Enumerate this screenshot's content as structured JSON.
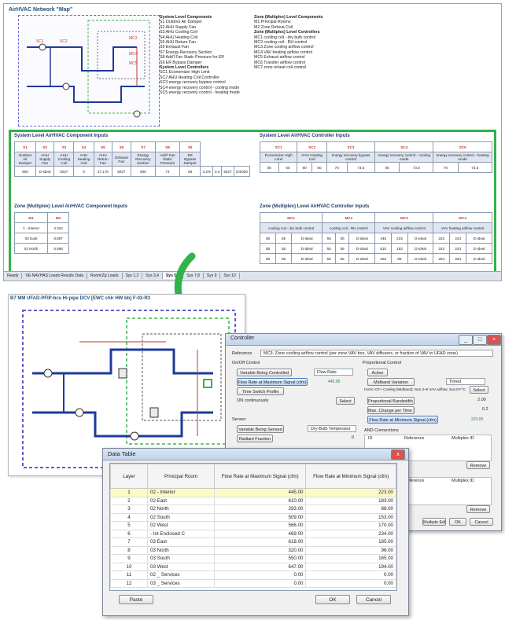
{
  "spreadsheet": {
    "title": "AirHVAC Network \"Map\"",
    "legend_sys_header": "System Level Components",
    "legend_zone_header": "Zone (Multiplex) Level Components",
    "legend_sys_items": [
      "S1   Outdoor Air Damper",
      "S2   AHU Supply Fan",
      "S3   AHU Cooling Coil",
      "S4   AHU Heating Coil",
      "S5   AHU Return Fan",
      "S6   Exhaust Fan",
      "S7   Energy Recovery Section",
      "S8   Add'l Fan Static Pressure for ER",
      "S9   ER Bypass Damper"
    ],
    "legend_zone_items": [
      "M1   Principal Rooms",
      "M2   Zone Reheat Coil"
    ],
    "legend_ctrl_header": "Zone (Multiplex) Level Controllers",
    "legend_ctrl_items": [
      "MC1  cooling coil - dry bulb control",
      "MC2  cooling coil - RH control",
      "MC3  Zone cooling airflow control",
      "MC4  VAV heating airflow control",
      "MC5  Exhaust airflow control",
      "MC6  Transfer airflow control",
      "MC7  zone reheat coil control"
    ],
    "legend_sysctrl_header": "System Level Controllers",
    "legend_sysctrl_items": [
      "SC1  Economizer High Limit",
      "SC2  AHU Heating Coil Controller",
      "SC3  energy recovery bypass control",
      "SC4  energy recovery control - cooling mode",
      "SC5  energy recovery control - heating mode"
    ],
    "sec1_title": "System Level AirHVAC Component Inputs",
    "sec2_title": "System Level AirHVAC Controller Inputs",
    "sec3_title": "Zone (Multiplex) Level AirHVAC Component Inputs",
    "sec4_title": "Zone (Multiplex) Level AirHVAC Controller Inputs",
    "comp_headers": [
      "S1",
      "S2",
      "S3",
      "S4",
      "S5",
      "S6",
      "S7",
      "S8",
      "S9"
    ],
    "comp_names": [
      "Outdoor Air Damper",
      "AHU Supply Fan",
      "AHU Cooling Coil",
      "AHU Heating Coil",
      "AHU Return Fan",
      "Exhaust Fan",
      "Energy Recovery Section",
      "Add'l Fan Static Pressure",
      "ER Bypass Damper"
    ],
    "comp_values": [
      "900",
      "D-Ideal",
      "5027",
      "0",
      "27,176",
      "5027",
      "800",
      "74",
      "68",
      "4.2%",
      "0.4",
      "5027",
      "100000"
    ],
    "ctrl_headers": [
      "SC1",
      "SC2",
      "SC3",
      "SC4",
      "SC5"
    ],
    "ctrl_names": [
      "Economizer High Limit",
      "AHU Heating Coil",
      "energy recovery bypass control",
      "energy recovery control - cooling mode",
      "energy recovery control - heating mode"
    ],
    "ctrl_values": [
      "55",
      "60",
      "60",
      "50",
      "70",
      "73.5",
      "55",
      "73.5",
      "70",
      "73.5"
    ],
    "zone_rows": [
      {
        "room": "1 - Interior",
        "value": "4.324"
      },
      {
        "room": "02 East",
        "value": "8.887"
      },
      {
        "room": "02 North",
        "value": "5.586"
      }
    ],
    "zone_ctrl_headers": [
      "MC1",
      "MC2",
      "MC3",
      "MC4"
    ],
    "zone_ctrl_names": [
      "cooling coil - dry bulb control",
      "cooling coil - RH control",
      "VAV cooling airflow control",
      "VAV heating airflow control"
    ],
    "zone_ctrl_values": [
      [
        "55",
        "55",
        "D-Ideal",
        "55",
        "55",
        "D-Ideal",
        "445",
        "223",
        "D-Ideal",
        "223",
        "223",
        "D-Ideal"
      ],
      [
        "55",
        "55",
        "D-Ideal",
        "55",
        "55",
        "D-Ideal",
        "610",
        "183",
        "D-Ideal",
        "243",
        "243",
        "D-Ideal"
      ],
      [
        "55",
        "55",
        "D-Ideal",
        "55",
        "55",
        "D-Ideal",
        "293",
        "88",
        "D-Ideal",
        "264",
        "264",
        "D-Ideal"
      ]
    ],
    "tabs": [
      "VE-NAVHAS Loads Results Data",
      "Room/Zg Loads",
      "Sys 1,2",
      "Sys 3,4",
      "Sys 5,6",
      "Sys 7,8",
      "Sys 9",
      "Sys 10"
    ],
    "active_tab": "Sys 5,6",
    "status": "Ready"
  },
  "network": {
    "title": "B7 MM UFAD-PFIP-bcs Hi-pipe DCV [EWC chlr HW bb] F-02-R3"
  },
  "controller": {
    "title": "Controller",
    "reference_label": "Reference",
    "reference_value": "MC3: Zone cooling airflow control (per zone VAV box, VAV diffusers, or fraction of VAV to UFAD zone)",
    "onoff_label": "On/Off Control",
    "variable_controlled_btn": "Variable Being Controlled",
    "variable_controlled_value": "Flow Rate",
    "flow_max_btn": "Flow Rate at Maximum Signal (cfm)",
    "flow_max_value": "445.00",
    "time_switch_btn": "Time Switch Profile",
    "time_switch_value": "ON continuously",
    "select_label": "Select",
    "sensor_label": "Sensor",
    "var_sensed_btn": "Variable Being Sensed",
    "var_sensed_value": "Dry-Bulb Temperatur",
    "radiant_btn": "Radiant Fraction",
    "radiant_value": "0",
    "proportional_label": "Proportional Control",
    "active_label": "Active",
    "midband_btn": "Midband Variation",
    "midband_value": "Timed",
    "hvac_profile": "HVAC-CF+ Cooling (Midband): Sus 3~8 VAV airflow; Sus 9 F°C",
    "prop_bandwidth_btn": "Proportional Bandwidth (°F)",
    "prop_bandwidth_value": "2.00",
    "max_change_btn": "Max. Change per Time Step",
    "max_change_value": "0.2",
    "flow_min_btn": "Flow Rate at Minimum Signal (cfm)",
    "flow_min_value": "223.00",
    "and_connections": "AND Connections",
    "and_cols": [
      "ID",
      "Reference",
      "Multiplex ID"
    ],
    "remove_label": "Remove",
    "multiple_edit": "Multiple Edit",
    "ok": "OK",
    "cancel": "Cancel"
  },
  "data_table": {
    "title": "Data Table",
    "columns": [
      "Layer",
      "Principal Room",
      "Flow Rate at Maximum Signal (cfm)",
      "Flow Rate at Minimum Signal (cfm)"
    ],
    "rows": [
      [
        "1",
        "02 - Interior",
        "445.00",
        "223.00"
      ],
      [
        "2",
        "02 East",
        "610.00",
        "183.00"
      ],
      [
        "3",
        "02 North",
        "293.00",
        "88.00"
      ],
      [
        "4",
        "02 South",
        "509.00",
        "153.00"
      ],
      [
        "5",
        "02 West",
        "566.00",
        "170.00"
      ],
      [
        "6",
        "- Int Enclosed C",
        "469.00",
        "234.00"
      ],
      [
        "7",
        "03 East",
        "618.00",
        "185.00"
      ],
      [
        "8",
        "03 North",
        "320.00",
        "96.00"
      ],
      [
        "9",
        "03 South",
        "550.00",
        "165.00"
      ],
      [
        "10",
        "03 West",
        "647.00",
        "194.00"
      ],
      [
        "11",
        "02 _ Services",
        "0.00",
        "0.00"
      ],
      [
        "12",
        "03 _ Services",
        "0.00",
        "0.00"
      ]
    ],
    "paste": "Paste",
    "ok": "OK",
    "cancel": "Cancel",
    "close": "x"
  }
}
